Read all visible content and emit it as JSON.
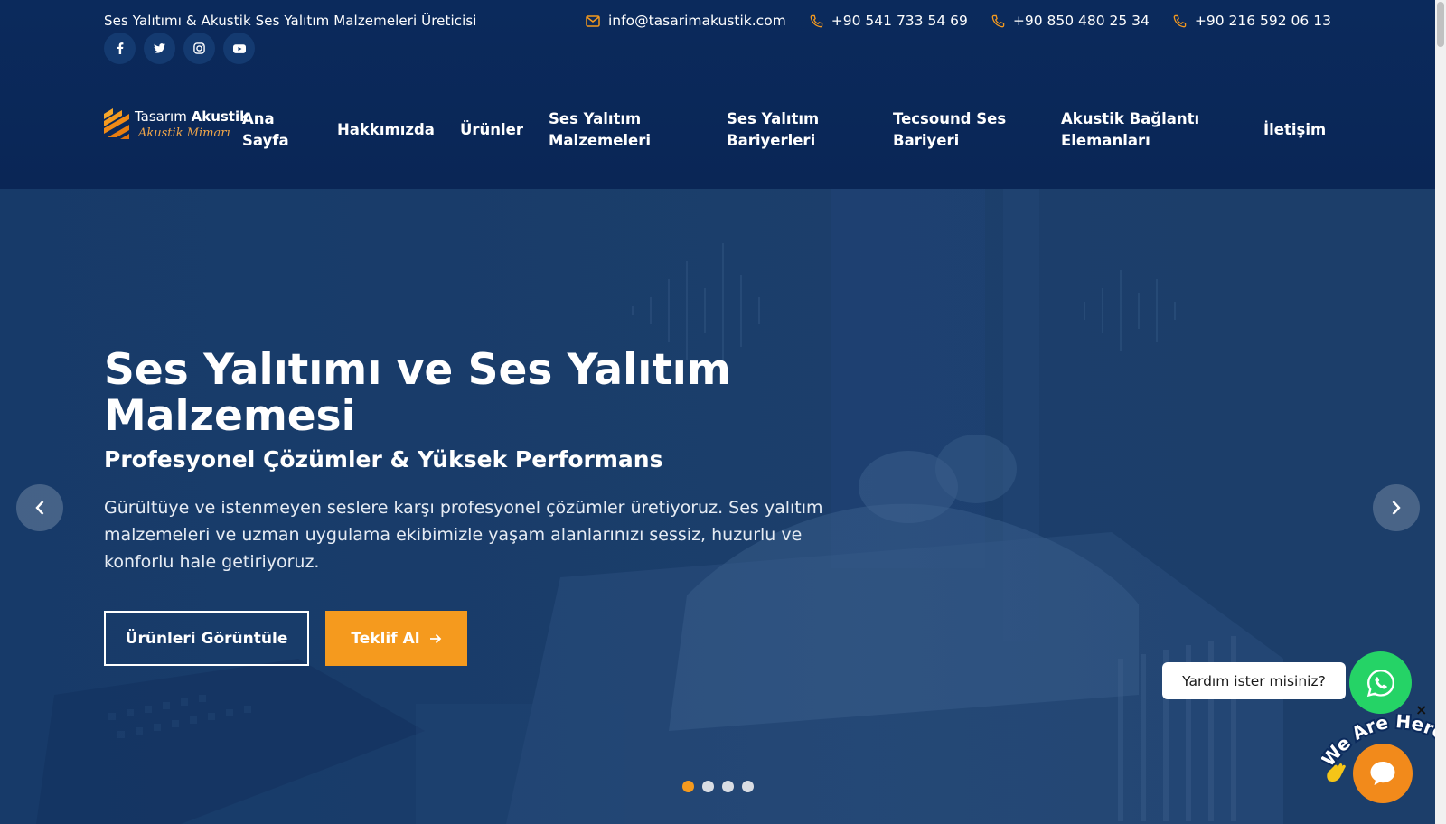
{
  "topbar": {
    "tagline": "Ses Yalıtımı & Akustik Ses Yalıtım Malzemeleri Üreticisi",
    "email": "info@tasarimakustik.com",
    "phones": [
      "+90 541 733 54 69",
      "+90 850 480 25 34",
      "+90 216 592 06 13"
    ],
    "socials": [
      "facebook-icon",
      "twitter-icon",
      "instagram-icon",
      "youtube-icon"
    ]
  },
  "logo": {
    "line1_light": "Tasarım",
    "line1_bold": "Akustik",
    "line2": "Akustik Mimarı"
  },
  "nav": {
    "items": [
      {
        "label": "Ana Sayfa"
      },
      {
        "label": "Hakkımızda"
      },
      {
        "label": "Ürünler"
      },
      {
        "label": "Ses Yalıtım Malzemeleri"
      },
      {
        "label": "Ses Yalıtım Bariyerleri"
      },
      {
        "label": "Tecsound Ses Bariyeri"
      },
      {
        "label": "Akustik Bağlantı Elemanları"
      },
      {
        "label": "İletişim"
      }
    ]
  },
  "hero": {
    "title": "Ses Yalıtımı ve Ses Yalıtım Malzemesi",
    "subtitle": "Profesyonel Çözümler & Yüksek Performans",
    "text": "Gürültüye ve istenmeyen seslere karşı profesyonel çözümler üretiyoruz. Ses yalıtım malzemeleri ve uzman uygulama ekibimizle yaşam alanlarınızı sessiz, huzurlu ve konforlu hale getiriyoruz.",
    "btn_products": "Ürünleri Görüntüle",
    "btn_quote": "Teklif Al",
    "slides": 4,
    "active_slide": 1
  },
  "widgets": {
    "help_text": "Yardım ister misiniz?",
    "badge_text": "We Are Here!",
    "close": "×"
  },
  "colors": {
    "accent": "#f59a1e",
    "navy": "#0b2a5c",
    "whatsapp": "#25d366"
  }
}
